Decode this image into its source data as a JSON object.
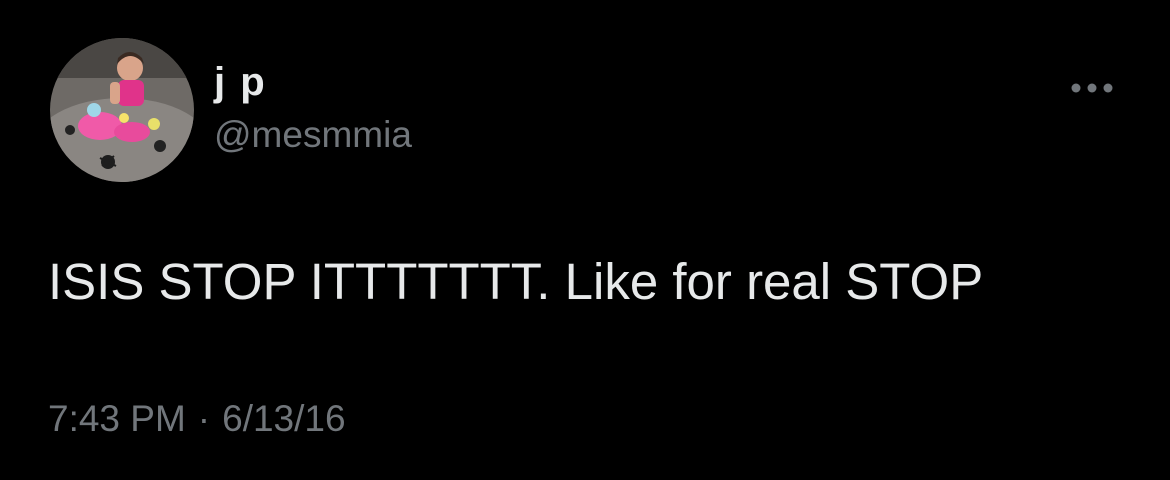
{
  "author": {
    "display_name": "j p",
    "handle": "@mesmmia"
  },
  "tweet": {
    "text": "ISIS STOP ITTTTTTT. Like for real STOP",
    "time": "7:43 PM",
    "separator": "·",
    "date": "6/13/16"
  },
  "icons": {
    "more": "more-horizontal-icon",
    "avatar": "profile-photo"
  },
  "colors": {
    "background": "#000000",
    "primary_text": "#e7e9ea",
    "secondary_text": "#71767b"
  }
}
